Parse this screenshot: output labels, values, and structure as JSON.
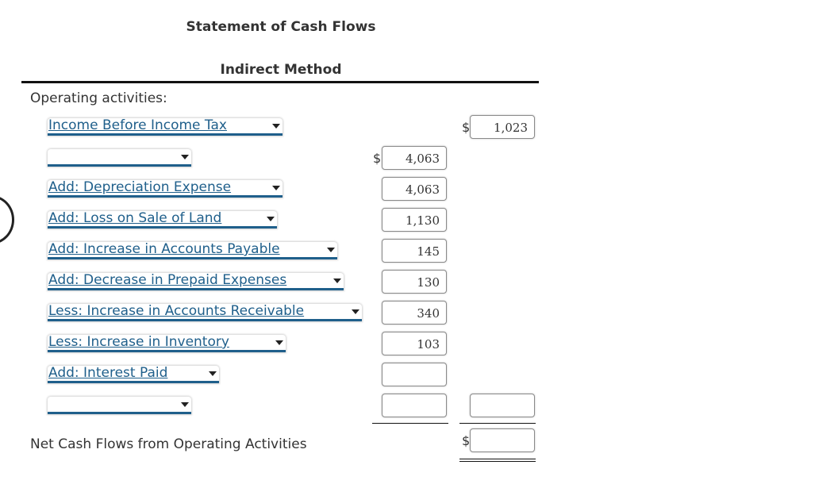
{
  "header": {
    "title": "Statement of Cash Flows",
    "subtitle": "Indirect Method"
  },
  "section": {
    "label": "Operating activities:"
  },
  "currency_symbol": "$",
  "rows": [
    {
      "select_value": "Income Before Income Tax",
      "col1_value": null,
      "col2_value": "1,023"
    },
    {
      "select_value": "",
      "col1_value": "4,063",
      "col2_value": null
    },
    {
      "select_value": "Add: Depreciation Expense",
      "col1_value": "4,063",
      "col2_value": null
    },
    {
      "select_value": "Add: Loss on Sale of Land",
      "col1_value": "1,130",
      "col2_value": null
    },
    {
      "select_value": "Add: Increase in Accounts Payable",
      "col1_value": "145",
      "col2_value": null
    },
    {
      "select_value": "Add: Decrease in Prepaid Expenses",
      "col1_value": "130",
      "col2_value": null
    },
    {
      "select_value": "Less: Increase in Accounts Receivable",
      "col1_value": "340",
      "col2_value": null
    },
    {
      "select_value": "Less: Increase in Inventory",
      "col1_value": "103",
      "col2_value": null
    },
    {
      "select_value": "Add: Interest Paid",
      "col1_value": "",
      "col2_value": null
    },
    {
      "select_value": "",
      "col1_value": "",
      "col2_value": ""
    }
  ],
  "net": {
    "label": "Net Cash Flows from Operating Activities",
    "value": ""
  }
}
